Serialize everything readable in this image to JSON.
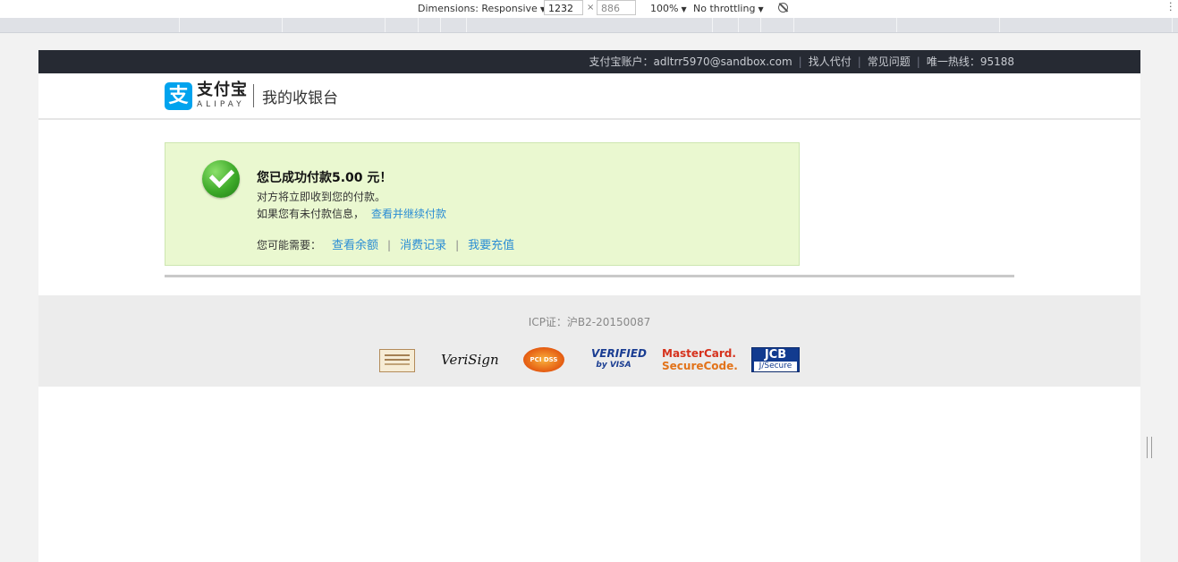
{
  "devtools": {
    "dimensions_label": "Dimensions: Responsive",
    "width_value": "1232",
    "height_value": "886",
    "times": "×",
    "zoom": "100%",
    "throttling": "No throttling",
    "dropdown_arrow": "▼"
  },
  "topbar": {
    "account": "支付宝账户：adltrr5970@sandbox.com",
    "find_payer": "找人代付",
    "faq": "常见问题",
    "hotline": "唯一热线：95188",
    "separator": "|"
  },
  "header": {
    "logo_mark": "支",
    "logo_cn": "支付宝",
    "logo_en": "ALIPAY",
    "title": "我的收银台"
  },
  "result": {
    "headline": "您已成功付款5.00 元！",
    "line1": "对方将立即收到您的付款。",
    "line2_text": "如果您有未付款信息，",
    "line2_link": "查看并继续付款",
    "needs_label": "您可能需要：",
    "actions": [
      "查看余额",
      "消费记录",
      "我要充值"
    ],
    "separator": "|"
  },
  "footer": {
    "icp": "ICP证：沪B2-20150087",
    "badges": {
      "verisign": "VeriSign",
      "pcidss": "PCI DSS",
      "visa_line1": "VERIFIED",
      "visa_line2": "by VISA",
      "mc_line1": "MasterCard.",
      "mc_line2": "SecureCode.",
      "jcb_line1": "JCB",
      "jcb_line2": "J/Secure"
    }
  },
  "colors": {
    "topbar_bg": "#262a33",
    "link": "#2a8dd4",
    "success_bg": "#eaf8d0",
    "alipay_blue": "#00a3ee"
  }
}
